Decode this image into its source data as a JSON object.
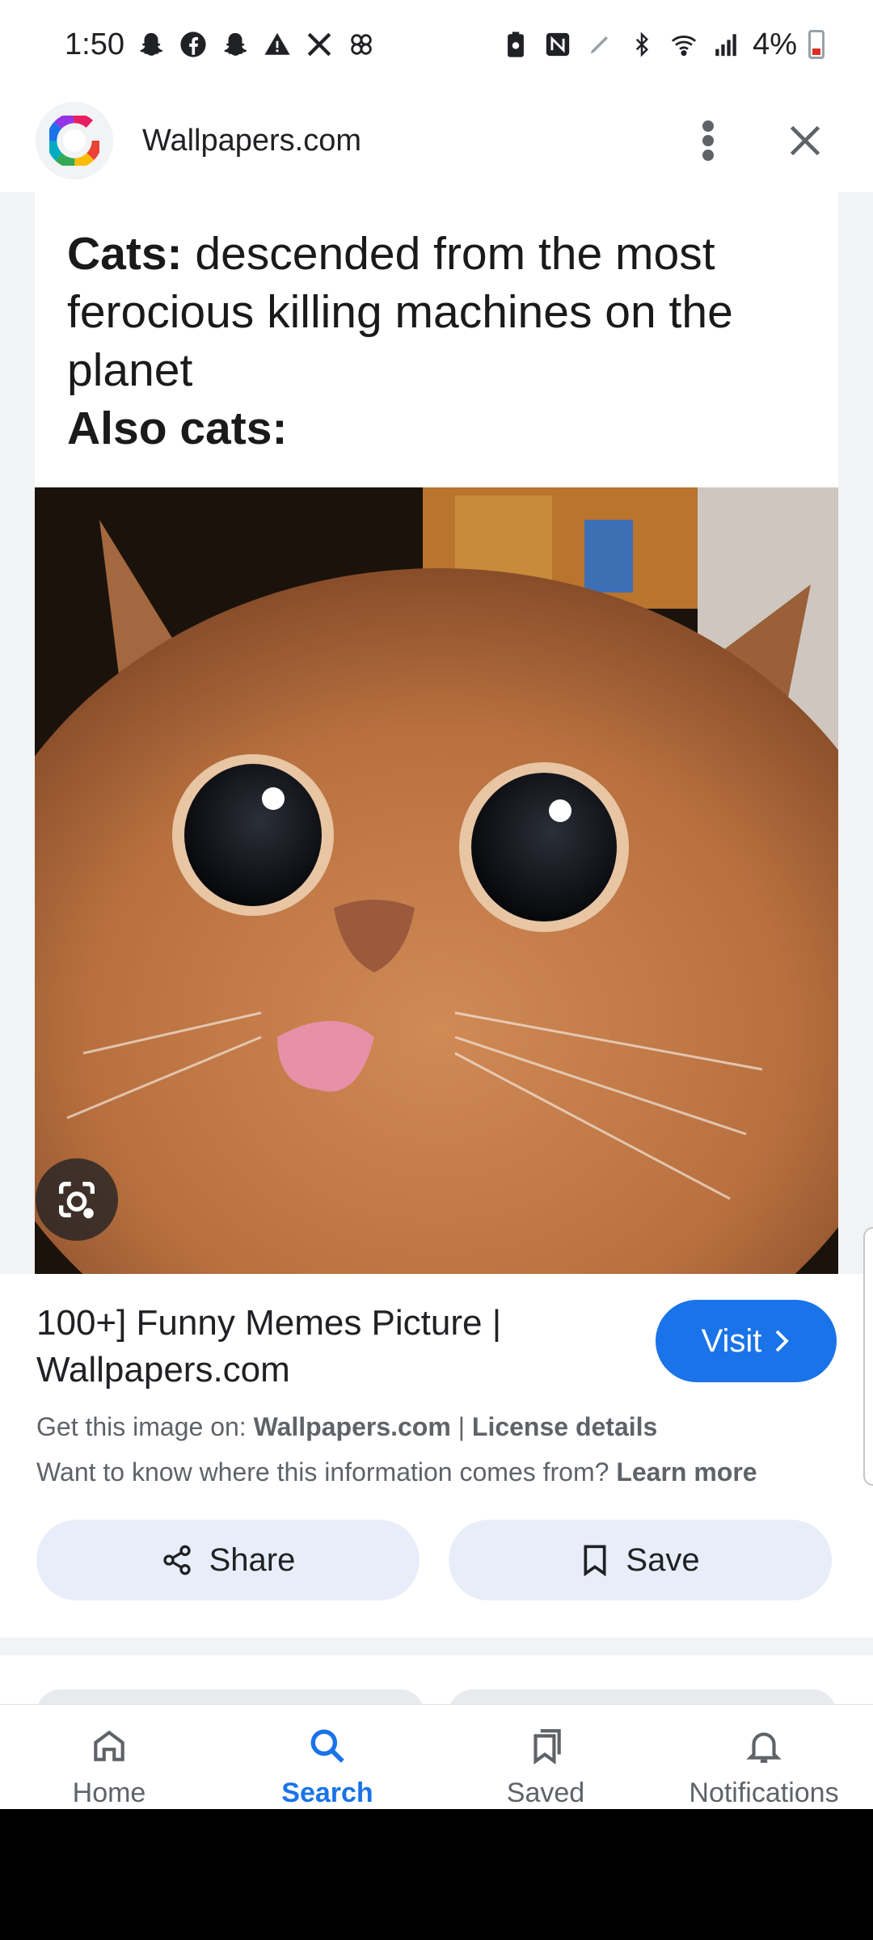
{
  "status_bar": {
    "time": "1:50",
    "battery": "4%",
    "left_icons": [
      "snapchat-icon",
      "facebook-icon",
      "snapchat-icon",
      "warning-icon",
      "tools-icon",
      "pinwheel-icon"
    ],
    "right_icons": [
      "battery-saver-icon",
      "nfc-icon",
      "pen-icon",
      "bluetooth-icon",
      "wifi-icon",
      "signal-icon"
    ]
  },
  "app_bar": {
    "site_title": "Wallpapers.com",
    "menu_icon": "more-vert-icon",
    "close_icon": "close-icon"
  },
  "meme": {
    "line1_bold": "Cats:",
    "line1_rest": " descended from the most ferocious killing machines on the planet",
    "line2_bold": "Also cats:"
  },
  "result": {
    "title": "100+] Funny Memes Picture | Wallpapers.com",
    "visit_label": "Visit",
    "get_image_prefix": "Get this image on: ",
    "get_image_site": "Wallpapers.com",
    "separator": " | ",
    "license_label": "License details",
    "info_question": "Want to know where this information comes from? ",
    "learn_more": "Learn more"
  },
  "actions": {
    "share_label": "Share",
    "save_label": "Save"
  },
  "bottom_nav": {
    "items": [
      {
        "label": "Home",
        "icon": "home-icon"
      },
      {
        "label": "Search",
        "icon": "search-icon",
        "active": true
      },
      {
        "label": "Saved",
        "icon": "saved-icon"
      },
      {
        "label": "Notifications",
        "icon": "bell-icon"
      }
    ]
  },
  "colors": {
    "accent": "#1a73e8",
    "pill_bg": "#e8eef9"
  }
}
